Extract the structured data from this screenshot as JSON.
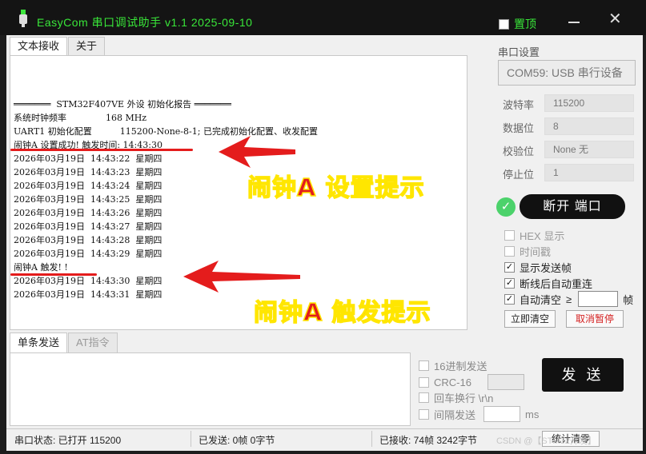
{
  "title": "EasyCom 串口调试助手 v1.1    2025-09-10",
  "pin_label": "置顶",
  "tabs": [
    "文本接收",
    "关于"
  ],
  "receive_lines": [
    "═══════  STM32F407VE 外设 初始化报告 ═══════",
    "系统时钟频率              168 MHz",
    "UART1 初始化配置          115200-None-8-1; 已完成初始化配置、收发配置",
    "闹钟A 设置成功! 触发时间: 14:43:30",
    "2026年03月19日  14:43:22  星期四",
    "2026年03月19日  14:43:23  星期四",
    "2026年03月19日  14:43:24  星期四",
    "2026年03月19日  14:43:25  星期四",
    "2026年03月19日  14:43:26  星期四",
    "2026年03月19日  14:43:27  星期四",
    "2026年03月19日  14:43:28  星期四",
    "2026年03月19日  14:43:29  星期四",
    "闹钟A 触发! !",
    "2026年03月19日  14:43:30  星期四",
    "2026年03月19日  14:43:31  星期四"
  ],
  "annotations": {
    "set_hint": "闹钟A 设置提示",
    "trigger_hint": "闹钟A 触发提示"
  },
  "serial": {
    "section_title": "串口设置",
    "port": "COM59: USB 串行设备",
    "baud_label": "波特率",
    "baud": "115200",
    "databits_label": "数据位",
    "databits": "8",
    "parity_label": "校验位",
    "parity": "None   无",
    "stopbits_label": "停止位",
    "stopbits": "1",
    "disconnect": "断开 端口"
  },
  "options": {
    "hex": "HEX 显示",
    "timestamp": "时间戳",
    "show_sent": "显示发送帧",
    "auto_reconnect": "断线后自动重连",
    "auto_clear": "自动清空",
    "auto_clear_ge": "≥",
    "frame_unit": "帧",
    "clear_now": "立即清空",
    "cancel_pause": "取消暂停"
  },
  "send_tabs": [
    "单条发送",
    "AT指令"
  ],
  "send_options": {
    "hex_send": "16进制发送",
    "crc": "CRC-16",
    "crlf": "回车换行 \\r\\n",
    "interval": "间隔发送",
    "ms": "ms",
    "send_button": "发 送"
  },
  "status": {
    "port_state": "串口状态: 已打开 115200",
    "sent": "已发送: 0帧    0字节",
    "received": "已接收: 74帧    3242字节",
    "stat_clear": "统计清零"
  },
  "watermark": "CSDN @【STM32开发】",
  "colors": {
    "accent_green": "#39e639",
    "alert_red": "#e21d1d",
    "outline_yellow": "#ffe600"
  }
}
